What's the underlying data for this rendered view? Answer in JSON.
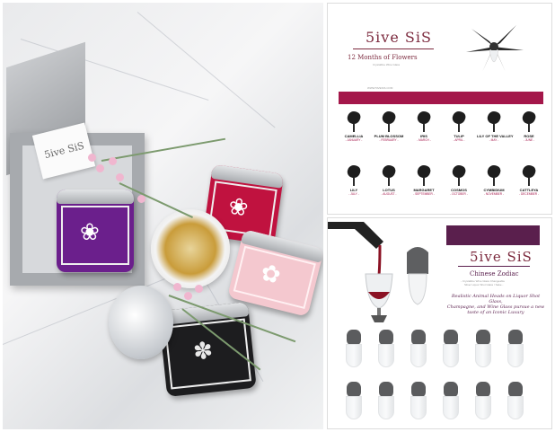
{
  "left_photo": {
    "card_logo": "5ive SiS"
  },
  "flowers_catalog": {
    "brand": "5ive SiS",
    "title": "12 Months of Flowers",
    "subtitle": "Crystalline Wine Glass",
    "url": "WWW.5IVESIS.COM",
    "accent_color": "#a4174a",
    "flowers": [
      {
        "name": "CAMELLIA",
        "month": "- JANUARY -"
      },
      {
        "name": "PLUM BLOSSOM",
        "month": "- FEBRUARY -"
      },
      {
        "name": "IRIS",
        "month": "- MARCH -"
      },
      {
        "name": "TULIP",
        "month": "- APRIL -"
      },
      {
        "name": "LILY OF THE VALLEY",
        "month": "- MAY -"
      },
      {
        "name": "ROSE",
        "month": "- JUNE -"
      },
      {
        "name": "LILY",
        "month": "- JULY -"
      },
      {
        "name": "LOTUS",
        "month": "- AUGUST -"
      },
      {
        "name": "MARGARET",
        "month": "- SEPTEMBER -"
      },
      {
        "name": "COSMOS",
        "month": "- OCTOBER -"
      },
      {
        "name": "CYMBIDIUM",
        "month": "- NOVEMBER -"
      },
      {
        "name": "CATTLEYA",
        "month": "- DECEMBER -"
      }
    ]
  },
  "zodiac_catalog": {
    "brand": "5ive SiS",
    "title": "Chinese Zodiac",
    "subtitle_line1": "- Crystalline Wine Glass Changeable",
    "subtitle_line2": "Silver Liquor Shot Glass / Sake -",
    "description_line1": "Realistic Animal Heads on Liquor Shot Glass,",
    "description_line2": "Champagne, and Wine Glass pursue a new",
    "description_line3": "taste of an Iconic Luxury",
    "accent_color": "#5a1f4d",
    "zodiac_count": 12
  }
}
